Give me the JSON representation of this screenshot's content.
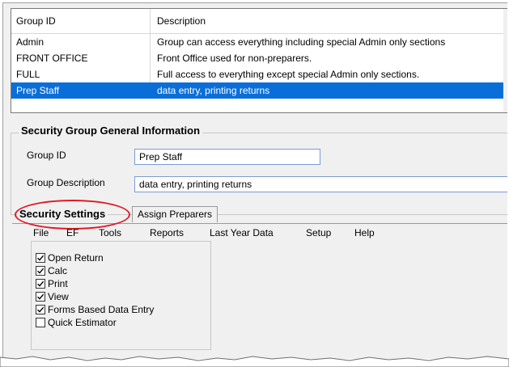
{
  "groups_grid": {
    "columns": [
      "Group ID",
      "Description"
    ],
    "rows": [
      {
        "id": "Admin",
        "description": "Group can access everything including special Admin only sections"
      },
      {
        "id": "FRONT OFFICE",
        "description": "Front Office used for non-preparers."
      },
      {
        "id": "FULL",
        "description": "Full access to everything except special Admin only sections."
      },
      {
        "id": "Prep Staff",
        "description": "data entry, printing returns",
        "selected": true
      }
    ]
  },
  "general_info": {
    "title": "Security Group General Information",
    "group_id_label": "Group ID",
    "group_id_value": "Prep Staff",
    "group_description_label": "Group Description",
    "group_description_value": "data entry, printing returns"
  },
  "tabs": {
    "security_settings": "Security Settings",
    "assign_preparers": "Assign Preparers"
  },
  "menu": [
    "File",
    "EF",
    "Tools",
    "Reports",
    "Last Year Data",
    "Setup",
    "Help"
  ],
  "permissions": [
    {
      "label": "Open Return",
      "checked": true
    },
    {
      "label": "Calc",
      "checked": true
    },
    {
      "label": "Print",
      "checked": true
    },
    {
      "label": "View",
      "checked": true
    },
    {
      "label": "Forms Based  Data Entry",
      "checked": true
    },
    {
      "label": "Quick Estimator",
      "checked": false
    }
  ],
  "colors": {
    "selection": "#0a6ed8",
    "highlight_oval": "#e01b24"
  }
}
